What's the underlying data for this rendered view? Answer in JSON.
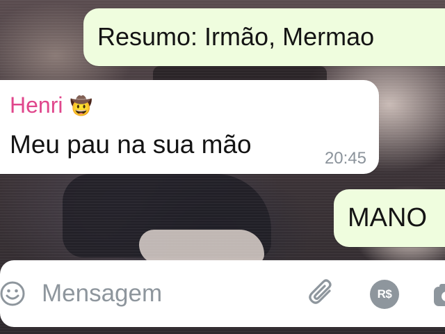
{
  "chat": {
    "messages": [
      {
        "direction": "outgoing",
        "text": "Resumo: Irmão, Mermao"
      },
      {
        "direction": "incoming",
        "sender": "Henri",
        "sender_emoji": "🤠",
        "text": "Meu pau na sua mão",
        "time": "20:45"
      },
      {
        "direction": "outgoing",
        "text": "MANO"
      }
    ]
  },
  "composer": {
    "placeholder": "Mensagem",
    "payment_label": "R$",
    "icons": [
      "emoji-icon",
      "attach-icon",
      "payment-icon",
      "camera-icon"
    ]
  },
  "colors": {
    "outgoing_bubble": "#effdde",
    "incoming_bubble": "#ffffff",
    "sender_name": "#e0478c",
    "timestamp": "#8b939b",
    "icon_gray": "#8e969d"
  }
}
